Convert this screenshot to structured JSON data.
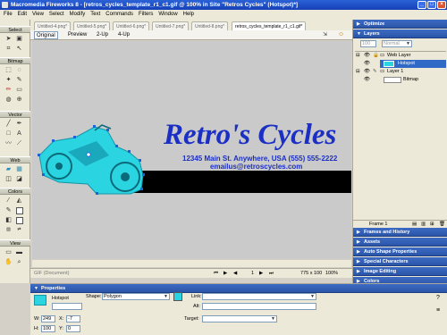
{
  "window": {
    "title": "Macromedia Fireworks 8 - [retros_cycles_template_r1_c1.gif @ 100% in Site \"Retros Cycles\" (Hotspot)*]",
    "min": "_",
    "max": "□",
    "close": "×"
  },
  "menu": [
    "File",
    "Edit",
    "View",
    "Select",
    "Modify",
    "Text",
    "Commands",
    "Filters",
    "Window",
    "Help"
  ],
  "tools": {
    "sections": [
      "Select",
      "Bitmap",
      "Vector",
      "Web",
      "Colors",
      "View"
    ]
  },
  "tabs": [
    {
      "label": "Untitled-4.png*"
    },
    {
      "label": "Untitled-5.png*"
    },
    {
      "label": "Untitled-6.png*"
    },
    {
      "label": "Untitled-7.png*"
    },
    {
      "label": "Untitled-8.png*"
    },
    {
      "label": "retros_cycles_template_r1_c1.gif*"
    }
  ],
  "views": {
    "original": "Original",
    "preview": "Preview",
    "two_up": "2-Up",
    "four_up": "4-Up"
  },
  "artwork": {
    "headline": "Retro's Cycles",
    "address": "12345 Main St. Anywhere, USA (555) 555-2222",
    "email": "emailus@retroscycles.com",
    "colors": {
      "headline": "#1b2fc4",
      "hotspot": "#2ad4e0",
      "band": "#000000",
      "canvas": "#cacaca"
    }
  },
  "status": {
    "doc": "GIF (Document)",
    "page": "1",
    "size": "775 x 100",
    "zoom": "100%"
  },
  "panels": {
    "optimize": "Optimize",
    "layers": {
      "title": "Layers",
      "opacity": "100",
      "blend": "Normal",
      "items": [
        {
          "name": "Web Layer"
        },
        {
          "name": "Hotspot"
        },
        {
          "name": "Layer 1"
        },
        {
          "name": "Bitmap"
        }
      ],
      "frame": "Frame 1"
    },
    "collapsed": [
      "Frames and History",
      "Assets",
      "Auto Shape Properties",
      "Special Characters",
      "Image Editing",
      "Colors"
    ]
  },
  "properties": {
    "title": "Properties",
    "object": "Hotspot",
    "shape_label": "Shape:",
    "shape_value": "Polygon",
    "link_label": "Link:",
    "alt_label": "Alt:",
    "target_label": "Target:",
    "w_label": "W:",
    "w_value": "249",
    "h_label": "H:",
    "h_value": "100",
    "x_label": "X:",
    "x_value": "-7",
    "y_label": "Y:",
    "y_value": "0",
    "hotspot_color": "#2ad4e0"
  }
}
